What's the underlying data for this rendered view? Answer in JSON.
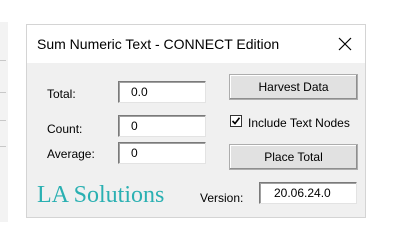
{
  "window": {
    "title": "Sum Numeric Text - CONNECT Edition",
    "close_glyph": "✕"
  },
  "fields": {
    "total_label": "Total:",
    "total_value": "0.0",
    "count_label": "Count:",
    "count_value": "0",
    "average_label": "Average:",
    "average_value": "0"
  },
  "buttons": {
    "harvest_label": "Harvest Data",
    "place_total_label": "Place Total"
  },
  "options": {
    "include_text_nodes_label": "Include Text Nodes",
    "include_text_nodes_checked": true,
    "check_glyph": "✓"
  },
  "footer": {
    "brand": "LA Solutions",
    "version_label": "Version:",
    "version_value": "20.06.24.0"
  }
}
